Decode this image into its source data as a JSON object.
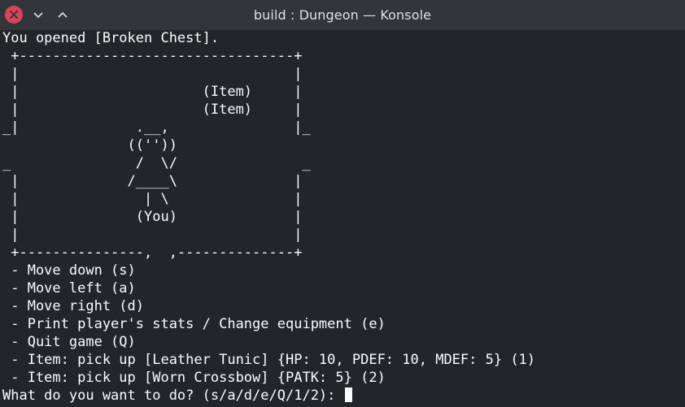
{
  "window": {
    "title": "build : Dungeon — Konsole"
  },
  "icons": {
    "close": "close-icon",
    "minimize": "chevron-down-icon",
    "maximize": "chevron-up-icon"
  },
  "colors": {
    "titlebar_bg": "#31363b",
    "terminal_bg": "#232629",
    "terminal_fg": "#fcfcfc",
    "close_button": "#da4453"
  },
  "terminal": {
    "lines": [
      "You opened [Broken Chest].",
      " +---------------------------------+",
      " |                                 |",
      " |                      (Item)     |",
      " |                      (Item)     |",
      "_|              .__,               |_",
      "               ((''))",
      "_               /  \\/               _",
      " |             /____\\              |",
      " |               | \\               |",
      " |              (You)              |",
      " |                                 |",
      " +---------------,  ,--------------+",
      " - Move down (s)",
      " - Move left (a)",
      " - Move right (d)",
      " - Print player's stats / Change equipment (e)",
      " - Quit game (Q)",
      " - Item: pick up [Leather Tunic] {HP: 10, PDEF: 10, MDEF: 5} (1)",
      " - Item: pick up [Worn Crossbow] {PATK: 5} (2)"
    ],
    "prompt": "What do you want to do? (s/a/d/e/Q/1/2): "
  }
}
